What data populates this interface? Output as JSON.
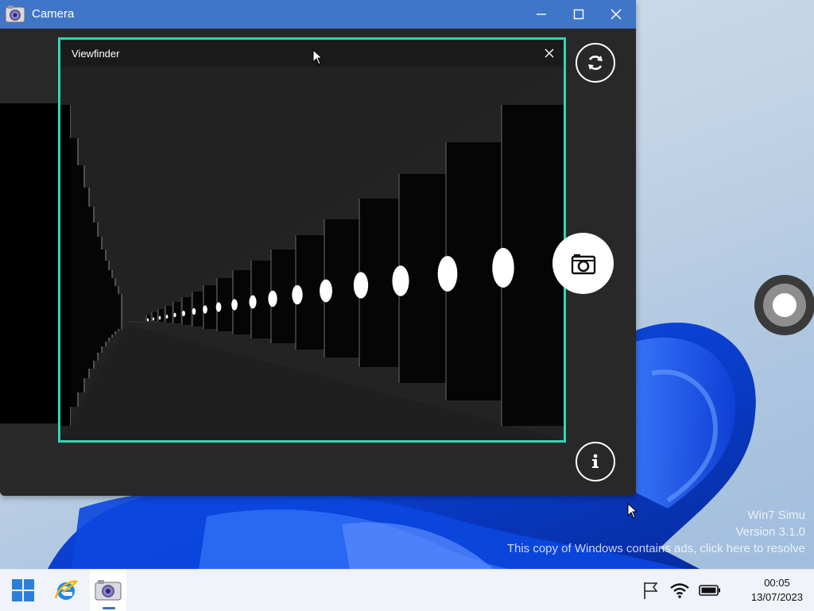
{
  "window": {
    "title": "Camera",
    "icon": "camera-app-icon",
    "controls": [
      "minimize-icon",
      "maximize-icon",
      "close-icon"
    ]
  },
  "viewfinder": {
    "title": "Viewfinder",
    "close_icon": "close-icon",
    "accent_color": "#2fd8b0"
  },
  "buttons": {
    "switch_camera": "rotate-camera-icon",
    "capture": "camera-icon",
    "info": "info-icon"
  },
  "watermark": {
    "line1": "Win7 Simu",
    "line2": "Version 3.1.0",
    "line3": "This copy of Windows contains ads, click here to resolve"
  },
  "taskbar": {
    "items": [
      "start-icon",
      "internet-explorer-icon",
      "camera-app-icon"
    ],
    "tray": [
      "flag-icon",
      "wifi-icon",
      "battery-icon"
    ],
    "time": "00:05",
    "date": "13/07/2023",
    "accent_color": "#3a6fc6"
  },
  "colors": {
    "titlebar": "#3f76c8",
    "window_bg": "#282828"
  }
}
